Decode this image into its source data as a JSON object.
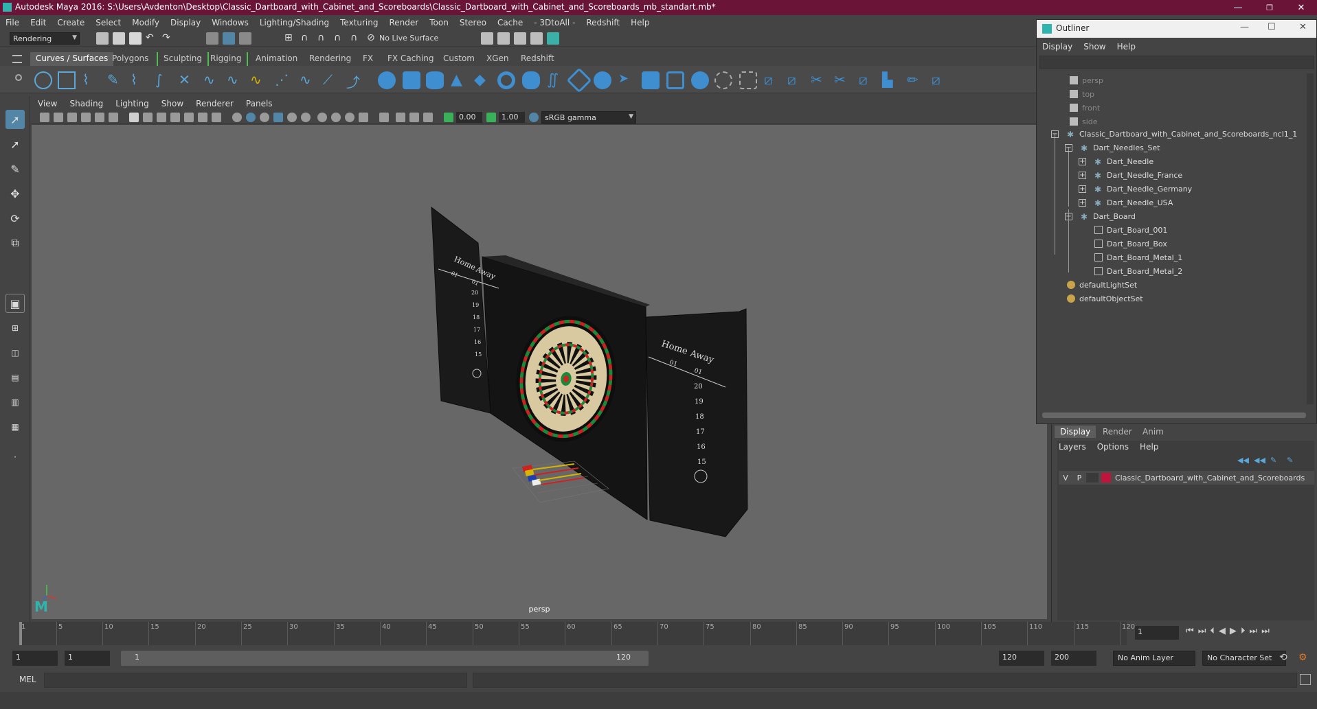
{
  "window": {
    "title": "Autodesk Maya 2016: S:\\Users\\Avdenton\\Desktop\\Classic_Dartboard_with_Cabinet_and_Scoreboards\\Classic_Dartboard_with_Cabinet_and_Scoreboards_mb_standart.mb*",
    "minimize": "—",
    "maximize": "❐",
    "close": "✕"
  },
  "menubar": [
    "File",
    "Edit",
    "Create",
    "Select",
    "Modify",
    "Display",
    "Windows",
    "Lighting/Shading",
    "Texturing",
    "Render",
    "Toon",
    "Stereo",
    "Cache",
    "- 3DtoAll -",
    "Redshift",
    "Help"
  ],
  "statusline": {
    "menuset": "Rendering",
    "live_surface": "No Live Surface"
  },
  "shelf_tabs": [
    "Curves / Surfaces",
    "Polygons",
    "Sculpting",
    "Rigging",
    "Animation",
    "Rendering",
    "FX",
    "FX Caching",
    "Custom",
    "XGen",
    "Redshift"
  ],
  "shelf_active": "Curves / Surfaces",
  "panel_menu": [
    "View",
    "Shading",
    "Lighting",
    "Show",
    "Renderer",
    "Panels"
  ],
  "panel_fields": {
    "exposure": "0.00",
    "gamma": "1.00",
    "colorspace": "sRGB gamma"
  },
  "viewport": {
    "camera_label": "persp",
    "scoreboard_left": {
      "home": "Home",
      "away": "Away",
      "left": "01",
      "right": "01",
      "numbers": [
        "20",
        "19",
        "18",
        "17",
        "16",
        "15"
      ]
    },
    "scoreboard_right": {
      "home": "Home",
      "away": "Away",
      "left": "01",
      "right": "01",
      "numbers": [
        "20",
        "19",
        "18",
        "17",
        "16",
        "15"
      ]
    }
  },
  "outliner": {
    "title": "Outliner",
    "menu": [
      "Display",
      "Show",
      "Help"
    ],
    "items": [
      {
        "label": "persp",
        "type": "camera",
        "dim": true
      },
      {
        "label": "top",
        "type": "camera",
        "dim": true
      },
      {
        "label": "front",
        "type": "camera",
        "dim": true
      },
      {
        "label": "side",
        "type": "camera",
        "dim": true
      },
      {
        "label": "Classic_Dartboard_with_Cabinet_and_Scoreboards_ncl1_1",
        "type": "group",
        "expander": "−"
      },
      {
        "label": "Dart_Needles_Set",
        "type": "group",
        "expander": "−"
      },
      {
        "label": "Dart_Needle",
        "type": "group",
        "expander": "+"
      },
      {
        "label": "Dart_Needle_France",
        "type": "group",
        "expander": "+"
      },
      {
        "label": "Dart_Needle_Germany",
        "type": "group",
        "expander": "+"
      },
      {
        "label": "Dart_Needle_USA",
        "type": "group",
        "expander": "+"
      },
      {
        "label": "Dart_Board",
        "type": "group",
        "expander": "−"
      },
      {
        "label": "Dart_Board_001",
        "type": "mesh"
      },
      {
        "label": "Dart_Board_Box",
        "type": "mesh"
      },
      {
        "label": "Dart_Board_Metal_1",
        "type": "mesh"
      },
      {
        "label": "Dart_Board_Metal_2",
        "type": "mesh"
      },
      {
        "label": "defaultLightSet",
        "type": "set"
      },
      {
        "label": "defaultObjectSet",
        "type": "set"
      }
    ]
  },
  "layer_editor": {
    "tabs": [
      "Display",
      "Render",
      "Anim"
    ],
    "menu": [
      "Layers",
      "Options",
      "Help"
    ],
    "layer": {
      "v": "V",
      "p": "P",
      "name": "Classic_Dartboard_with_Cabinet_and_Scoreboards",
      "color": "#c0143c"
    }
  },
  "timeline": {
    "ticks": [
      "1",
      "5",
      "10",
      "15",
      "20",
      "25",
      "30",
      "35",
      "40",
      "45",
      "50",
      "55",
      "60",
      "65",
      "70",
      "75",
      "80",
      "85",
      "90",
      "95",
      "100",
      "105",
      "110",
      "115",
      "120"
    ],
    "current_frame": "1"
  },
  "range": {
    "start": "1",
    "anim_start": "1",
    "slider_start": "1",
    "slider_end": "120",
    "anim_end": "120",
    "end": "200",
    "anim_layer": "No Anim Layer",
    "character_set": "No Character Set"
  },
  "cmdline": {
    "label": "MEL"
  },
  "colors": {
    "titlebar": "#6a1538",
    "accent": "#5285a6",
    "viewport_bg": "#676767"
  }
}
